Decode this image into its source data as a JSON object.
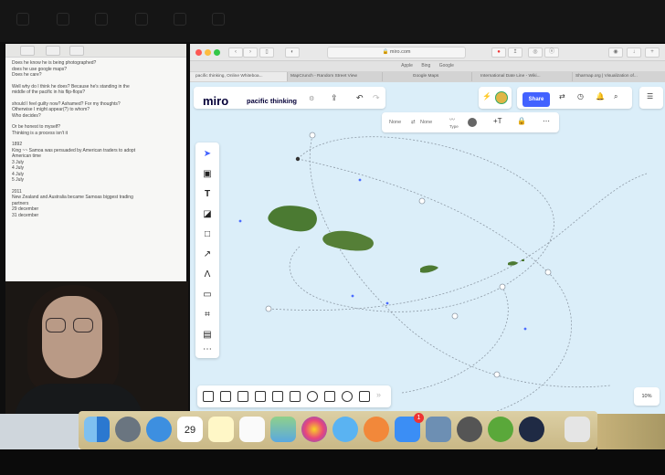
{
  "notes": {
    "lines": [
      "Does he know he is being photographed?",
      "does he use google maps?",
      "Does he care?",
      "",
      "Well why do I think he does? Because he's standing in the",
      "middle of the pacific in his flip-flops?",
      "",
      "should I feel guilty now? Ashamed? For my thoughts?",
      "Otherwise I might appear(?) to whom?",
      "Who decides?",
      "",
      "Or be honest to myself?",
      "Thinking is a process isn't it",
      "",
      "1892",
      "King ~~ Samoa was persuaded by American traders to adopt",
      "American time",
      "3 July",
      "4 July",
      "4 July",
      "5 July",
      "",
      "2011",
      "New Zealand and Australia became Samoas biggest trading",
      "partners",
      "29 december",
      "31 december"
    ]
  },
  "browser": {
    "url": "miro.com",
    "bookmarks": [
      "Apple",
      "Bing",
      "Google"
    ],
    "tabs": [
      "pacific thinking, Online Whiteboa...",
      "MapCrunch - Random Street View",
      "Google Maps",
      "International Date Line - Wiki...",
      "Sharmap.org | Visualization of..."
    ]
  },
  "miro": {
    "logo": "miro",
    "board_name": "pacific thinking",
    "share_label": "Share",
    "zoom": "10%",
    "context_toolbar": {
      "none_1": "None",
      "none_2": "None",
      "type": "Type"
    }
  },
  "colors": {
    "canvas": "#dbeef9",
    "miro_blue": "#4262ff",
    "island": "#4b7a32",
    "dock": "#d8c99a"
  },
  "icons": {
    "left_toolbar": [
      "cursor-icon",
      "frame-icon",
      "text-icon",
      "sticky-note-icon",
      "shape-icon",
      "pen-icon",
      "connector-icon",
      "comment-icon",
      "crop-icon",
      "template-icon",
      "more-icon"
    ],
    "dock": [
      "finder-icon",
      "launchpad-icon",
      "safari-icon",
      "calendar-icon",
      "notes-icon",
      "reminders-icon",
      "maps-icon",
      "photos-icon",
      "messages-icon",
      "books-icon",
      "app-store-icon",
      "preview-icon",
      "system-preferences-icon",
      "utorrent-icon",
      "quicktime-icon",
      "trash-icon"
    ]
  },
  "dock": {
    "calendar_day": "29",
    "app_store_badge": "1"
  }
}
